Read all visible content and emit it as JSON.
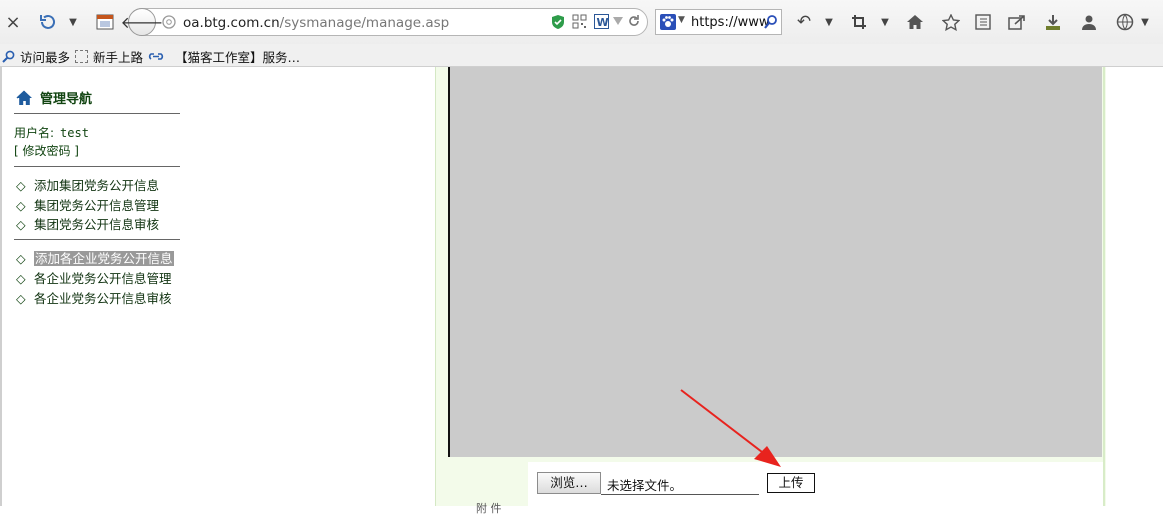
{
  "browser": {
    "close_glyph": "×",
    "address": {
      "host": "oa.btg.com.cn",
      "path": "/sysmanage/manage.asp"
    },
    "search": {
      "text": "https://www"
    },
    "bookmarks": [
      {
        "label": "访问最多"
      },
      {
        "label": "新手上路"
      },
      {
        "label": "【猫客工作室】服务…"
      }
    ]
  },
  "nav": {
    "title": "管理导航",
    "user_label": "用户名:",
    "user_value": "test",
    "change_password": "[ 修改密码 ]",
    "diamond": "◇",
    "group1": [
      {
        "label": "添加集团党务公开信息"
      },
      {
        "label": "集团党务公开信息管理"
      },
      {
        "label": "集团党务公开信息审核"
      }
    ],
    "group2": [
      {
        "label": "添加各企业党务公开信息",
        "selected": true
      },
      {
        "label": "各企业党务公开信息管理"
      },
      {
        "label": "各企业党务公开信息审核"
      }
    ]
  },
  "upload": {
    "browse_label": "浏览…",
    "no_file_text": "未选择文件。",
    "upload_label": "上传",
    "cut_label": "附 件"
  },
  "colors": {
    "nav_text": "#114411",
    "editor_bg": "#cbcbcb",
    "arrow": "#e8231e",
    "content_bg": "#f3fbea"
  }
}
